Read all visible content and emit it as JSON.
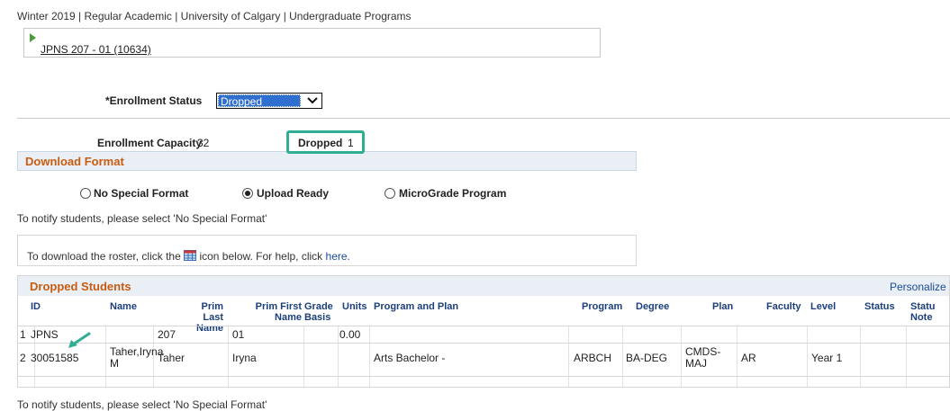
{
  "header": {
    "breadcrumb": "Winter 2019 | Regular Academic | University of Calgary | Undergraduate Programs"
  },
  "course": {
    "link": "JPNS 207 - 01 (10634)"
  },
  "enrollment": {
    "status_label": "*Enrollment Status",
    "status_value": "Dropped",
    "capacity_label": "Enrollment Capacity",
    "capacity_value": "32",
    "dropped_label": "Dropped",
    "dropped_value": "1"
  },
  "download_format": {
    "title": "Download Format",
    "options": [
      "No Special Format",
      "Upload Ready",
      "MicroGrade Program"
    ],
    "selected": "Upload Ready",
    "notify_text": "To notify students, please select 'No Special Format'",
    "download_prefix": "To download the roster, click the",
    "download_suffix": "icon below. For help, click",
    "help_link": "here."
  },
  "grid": {
    "title": "Dropped Students",
    "personalize": "Personalize",
    "columns": [
      "ID",
      "Name",
      "Prim Last Name",
      "Prim First Name",
      "Grade Basis",
      "Units",
      "Program and Plan",
      "Program",
      "Degree",
      "Plan",
      "Faculty",
      "Level",
      "Status",
      "Status Note"
    ],
    "rows": [
      {
        "num": "1",
        "id": "JPNS",
        "name": "",
        "last": "207",
        "first": "01",
        "grade": "",
        "units": "0.00",
        "program_plan": "",
        "program": "",
        "degree": "",
        "plan": "",
        "faculty": "",
        "level": "",
        "status": ""
      },
      {
        "num": "2",
        "id": "30051585",
        "name": "Taher,Iryna M",
        "last": "Taher",
        "first": "Iryna",
        "grade": "",
        "units": "",
        "program_plan": "Arts Bachelor -",
        "program": "ARBCH",
        "degree": "BA-DEG",
        "plan": "CMDS-MAJ",
        "faculty": "AR",
        "level": "Year 1",
        "status": ""
      }
    ]
  },
  "footer": {
    "notify_text": "To notify students, please select 'No Special Format'"
  },
  "colors": {
    "accent": "#c95c12",
    "link": "#1a4a9a",
    "highlight": "#2fae94",
    "select": "#2f6fd0"
  },
  "icons": [
    "play-triangle-icon",
    "dropdown-arrow-icon",
    "spreadsheet-icon",
    "green-pointer-arrow"
  ]
}
